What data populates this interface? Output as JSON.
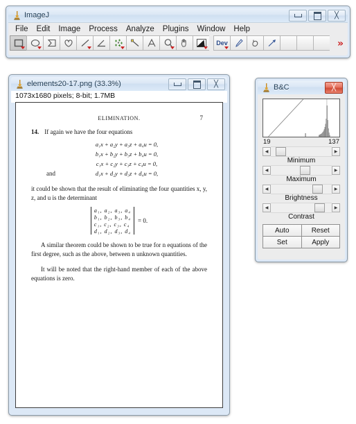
{
  "imagej": {
    "title": "ImageJ",
    "icon": "microscope-icon",
    "window_buttons": [
      {
        "name": "minimize-button",
        "glyph": "minimize-icon"
      },
      {
        "name": "maximize-button",
        "glyph": "maximize-icon"
      },
      {
        "name": "close-button",
        "glyph": "close-icon"
      }
    ],
    "menus": [
      "File",
      "Edit",
      "Image",
      "Process",
      "Analyze",
      "Plugins",
      "Window",
      "Help"
    ],
    "tools": [
      {
        "name": "rectangle-tool",
        "icon": "rectangle-icon",
        "selected": true,
        "dropdown": true
      },
      {
        "name": "oval-tool",
        "icon": "oval-icon",
        "selected": false,
        "dropdown": true
      },
      {
        "name": "polygon-tool",
        "icon": "polygon-icon",
        "selected": false,
        "dropdown": false
      },
      {
        "name": "freehand-tool",
        "icon": "freehand-icon",
        "selected": false,
        "dropdown": false
      },
      {
        "name": "line-tool",
        "icon": "line-icon",
        "selected": false,
        "dropdown": true
      },
      {
        "name": "angle-tool",
        "icon": "angle-icon",
        "selected": false,
        "dropdown": false
      },
      {
        "name": "point-tool",
        "icon": "point-multipoint-icon",
        "selected": false,
        "dropdown": true
      },
      {
        "name": "wand-tool",
        "icon": "wand-icon",
        "selected": false,
        "dropdown": false
      },
      {
        "name": "text-tool",
        "icon": "text-a-icon",
        "selected": false,
        "dropdown": false
      },
      {
        "name": "magnifier-tool",
        "icon": "magnifier-icon",
        "selected": false,
        "dropdown": true
      },
      {
        "name": "hand-tool",
        "icon": "hand-icon",
        "selected": false,
        "dropdown": false
      },
      {
        "name": "dropper-tool",
        "icon": "color-picker-icon",
        "selected": false,
        "dropdown": true
      },
      {
        "name": "dev-tool",
        "icon": "dev-label-icon",
        "label": "Dev",
        "selected": false,
        "dropdown": true
      },
      {
        "name": "brush-tool",
        "icon": "paintbrush-icon",
        "selected": false,
        "dropdown": false
      },
      {
        "name": "flood-fill-tool",
        "icon": "flood-fill-icon",
        "selected": false,
        "dropdown": false
      },
      {
        "name": "arrow-tool",
        "icon": "arrow-icon",
        "selected": false,
        "dropdown": false
      },
      {
        "name": "empty-slot-1",
        "icon": "",
        "selected": false,
        "dropdown": false
      },
      {
        "name": "empty-slot-2",
        "icon": "",
        "selected": false,
        "dropdown": false
      },
      {
        "name": "empty-slot-3",
        "icon": "",
        "selected": false,
        "dropdown": false
      }
    ],
    "more_tools_glyph": "»",
    "status_text": ""
  },
  "image_window": {
    "title": "elements20-17.png (33.3%)",
    "icon": "microscope-icon",
    "info_line": "1073x1680 pixels; 8-bit; 1.7MB",
    "window_buttons": [
      {
        "name": "minimize-button",
        "glyph": "minimize-icon"
      },
      {
        "name": "maximize-button",
        "glyph": "maximize-icon"
      },
      {
        "name": "close-button",
        "glyph": "close-icon"
      }
    ],
    "document": {
      "running_head": "ELIMINATION.",
      "page_number": "7",
      "section_number": "14.",
      "intro_text": "If again we have the four equations",
      "equations": [
        "a₁x + a₂y + a₃z + a₄u = 0,",
        "b₁x + b₂y + b₃z + b₄u = 0,",
        "c₁x + c₂y + c₃z + c₄u = 0,",
        "d₁x + d₂y + d₃z + d₄u = 0,"
      ],
      "and_label": "and",
      "after_text": "it could be shown that the result of eliminating the four quantities x, y, z, and u is the determinant",
      "determinant_rows": [
        "a₁, a₂, a₃, a₄",
        "b₁, b₂, b₃, b₄",
        "c₁, c₂, c₃, c₄",
        "d₁, d₂, d₃, d₄"
      ],
      "determinant_equals": "= 0.",
      "paragraph_2": "A similar theorem could be shown to be true for n equations of the first degree, such as the above, between n unknown quantities.",
      "paragraph_3": "It will be noted that the right-hand member of each of the above equations is zero."
    }
  },
  "bc_window": {
    "title": "B&C",
    "icon": "microscope-icon",
    "close_button": {
      "name": "close-button",
      "glyph": "close-icon",
      "color": "#cf4a34"
    },
    "hist_min_label": "19",
    "hist_max_label": "137",
    "sliders": [
      {
        "name": "minimum-slider",
        "label": "Minimum",
        "thumb_pct": 8
      },
      {
        "name": "maximum-slider",
        "label": "Maximum",
        "thumb_pct": 48
      },
      {
        "name": "brightness-slider",
        "label": "Brightness",
        "thumb_pct": 68
      },
      {
        "name": "contrast-slider",
        "label": "Contrast",
        "thumb_pct": 72
      }
    ],
    "buttons": [
      "Auto",
      "Reset",
      "Set",
      "Apply"
    ],
    "arrow_left_glyph": "◀",
    "arrow_right_glyph": "▶"
  },
  "chart_data": {
    "type": "bar",
    "title": "B&C histogram",
    "xlabel": "",
    "ylabel": "",
    "categories": [
      "19",
      "137"
    ],
    "xlim": [
      19,
      137
    ],
    "grid": false,
    "legend": "none",
    "annotations": [
      "diagonal LUT ramp line from bottom-left to top-right"
    ],
    "values": [
      0,
      0,
      0,
      0,
      0,
      0,
      0,
      0,
      0,
      0,
      0,
      0,
      0,
      0,
      0,
      0,
      0,
      0,
      0,
      0,
      0,
      0,
      0,
      0,
      0,
      0,
      0,
      0,
      0,
      0,
      0,
      0,
      0,
      0,
      0,
      0,
      0,
      0,
      0,
      0,
      0,
      0,
      0,
      0,
      0,
      0,
      0,
      0,
      0,
      0,
      0,
      0,
      0,
      0,
      0,
      0,
      0,
      0,
      0,
      0,
      0,
      0,
      0,
      0,
      0,
      4,
      0,
      0,
      0,
      0,
      0,
      0,
      0,
      0,
      0,
      0,
      0,
      0,
      0,
      0,
      0,
      0,
      0,
      0,
      0,
      0,
      2,
      3,
      4,
      5,
      7,
      9,
      12,
      16,
      22,
      30,
      42,
      60,
      100,
      55,
      20,
      8,
      3,
      1,
      0,
      0,
      0,
      0,
      0,
      0,
      0,
      0,
      0,
      0,
      0,
      0,
      0,
      0
    ]
  }
}
